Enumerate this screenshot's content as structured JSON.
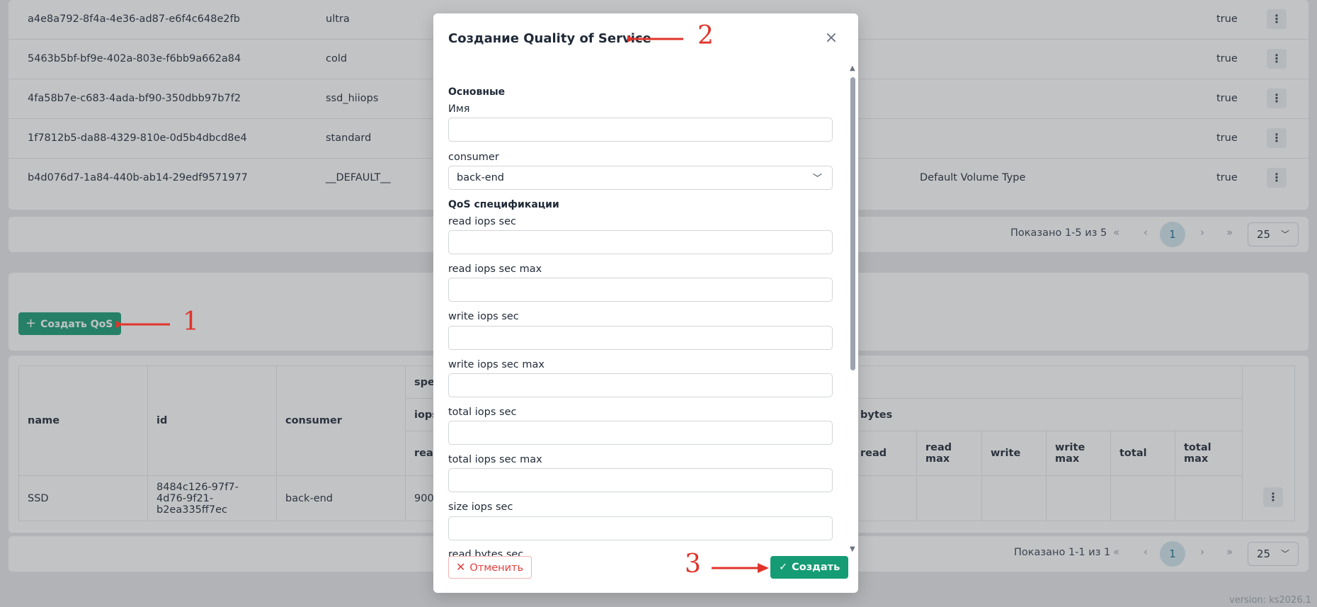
{
  "volume_types": {
    "rows": [
      {
        "id": "a4e8a792-8f4a-4e36-ad87-e6f4c648e2fb",
        "name": "ultra",
        "description": "",
        "is_public": "true"
      },
      {
        "id": "5463b5bf-bf9e-402a-803e-f6bb9a662a84",
        "name": "cold",
        "description": "",
        "is_public": "true"
      },
      {
        "id": "4fa58b7e-c683-4ada-bf90-350dbb97b7f2",
        "name": "ssd_hiiops",
        "description": "",
        "is_public": "true"
      },
      {
        "id": "1f7812b5-da88-4329-810e-0d5b4dbcd8e4",
        "name": "standard",
        "description": "",
        "is_public": "true"
      },
      {
        "id": "b4d076d7-1a84-440b-ab14-29edf9571977",
        "name": "__DEFAULT__",
        "description": "Default Volume Type",
        "is_public": "true"
      }
    ],
    "pager": {
      "info": "Показано 1-5 из 5",
      "page": "1",
      "page_size": "25"
    }
  },
  "toolbar": {
    "create_qos_label": "Создать QoS"
  },
  "qos_table": {
    "headers": {
      "name": "name",
      "id": "id",
      "consumer": "consumer",
      "specs_partial": "spe",
      "iops_partial": "iops",
      "read_partial": "reac",
      "bytes": "bytes",
      "read": "read",
      "read_max": "read max",
      "write": "write",
      "write_max": "write max",
      "total": "total",
      "total_max": "total max"
    },
    "row": {
      "name": "SSD",
      "id": "8484c126-97f7-4d76-9f21-b2ea335ff7ec",
      "consumer": "back-end",
      "read_partial": "900"
    },
    "pager": {
      "info": "Показано 1-1 из 1",
      "page": "1",
      "page_size": "25"
    }
  },
  "version": "version: ks2026.1",
  "modal": {
    "title": "Создание Quality of Service",
    "section_basic": "Основные",
    "name_label": "Имя",
    "name_value": "",
    "consumer_label": "consumer",
    "consumer_value": "back-end",
    "section_specs": "QoS спецификации",
    "spec_fields": [
      {
        "label": "read iops sec",
        "value": ""
      },
      {
        "label": "read iops sec max",
        "value": ""
      },
      {
        "label": "write iops sec",
        "value": ""
      },
      {
        "label": "write iops sec max",
        "value": ""
      },
      {
        "label": "total iops sec",
        "value": ""
      },
      {
        "label": "total iops sec max",
        "value": ""
      },
      {
        "label": "size iops sec",
        "value": ""
      },
      {
        "label": "read bytes sec",
        "value": ""
      }
    ],
    "cancel_label": "Отменить",
    "submit_label": "Создать"
  },
  "annotations": {
    "step1": "1",
    "step2": "2",
    "step3": "3",
    "arrow_color": "#e0342b"
  },
  "colors": {
    "primary": "#169c74",
    "danger": "#e53e3e"
  }
}
